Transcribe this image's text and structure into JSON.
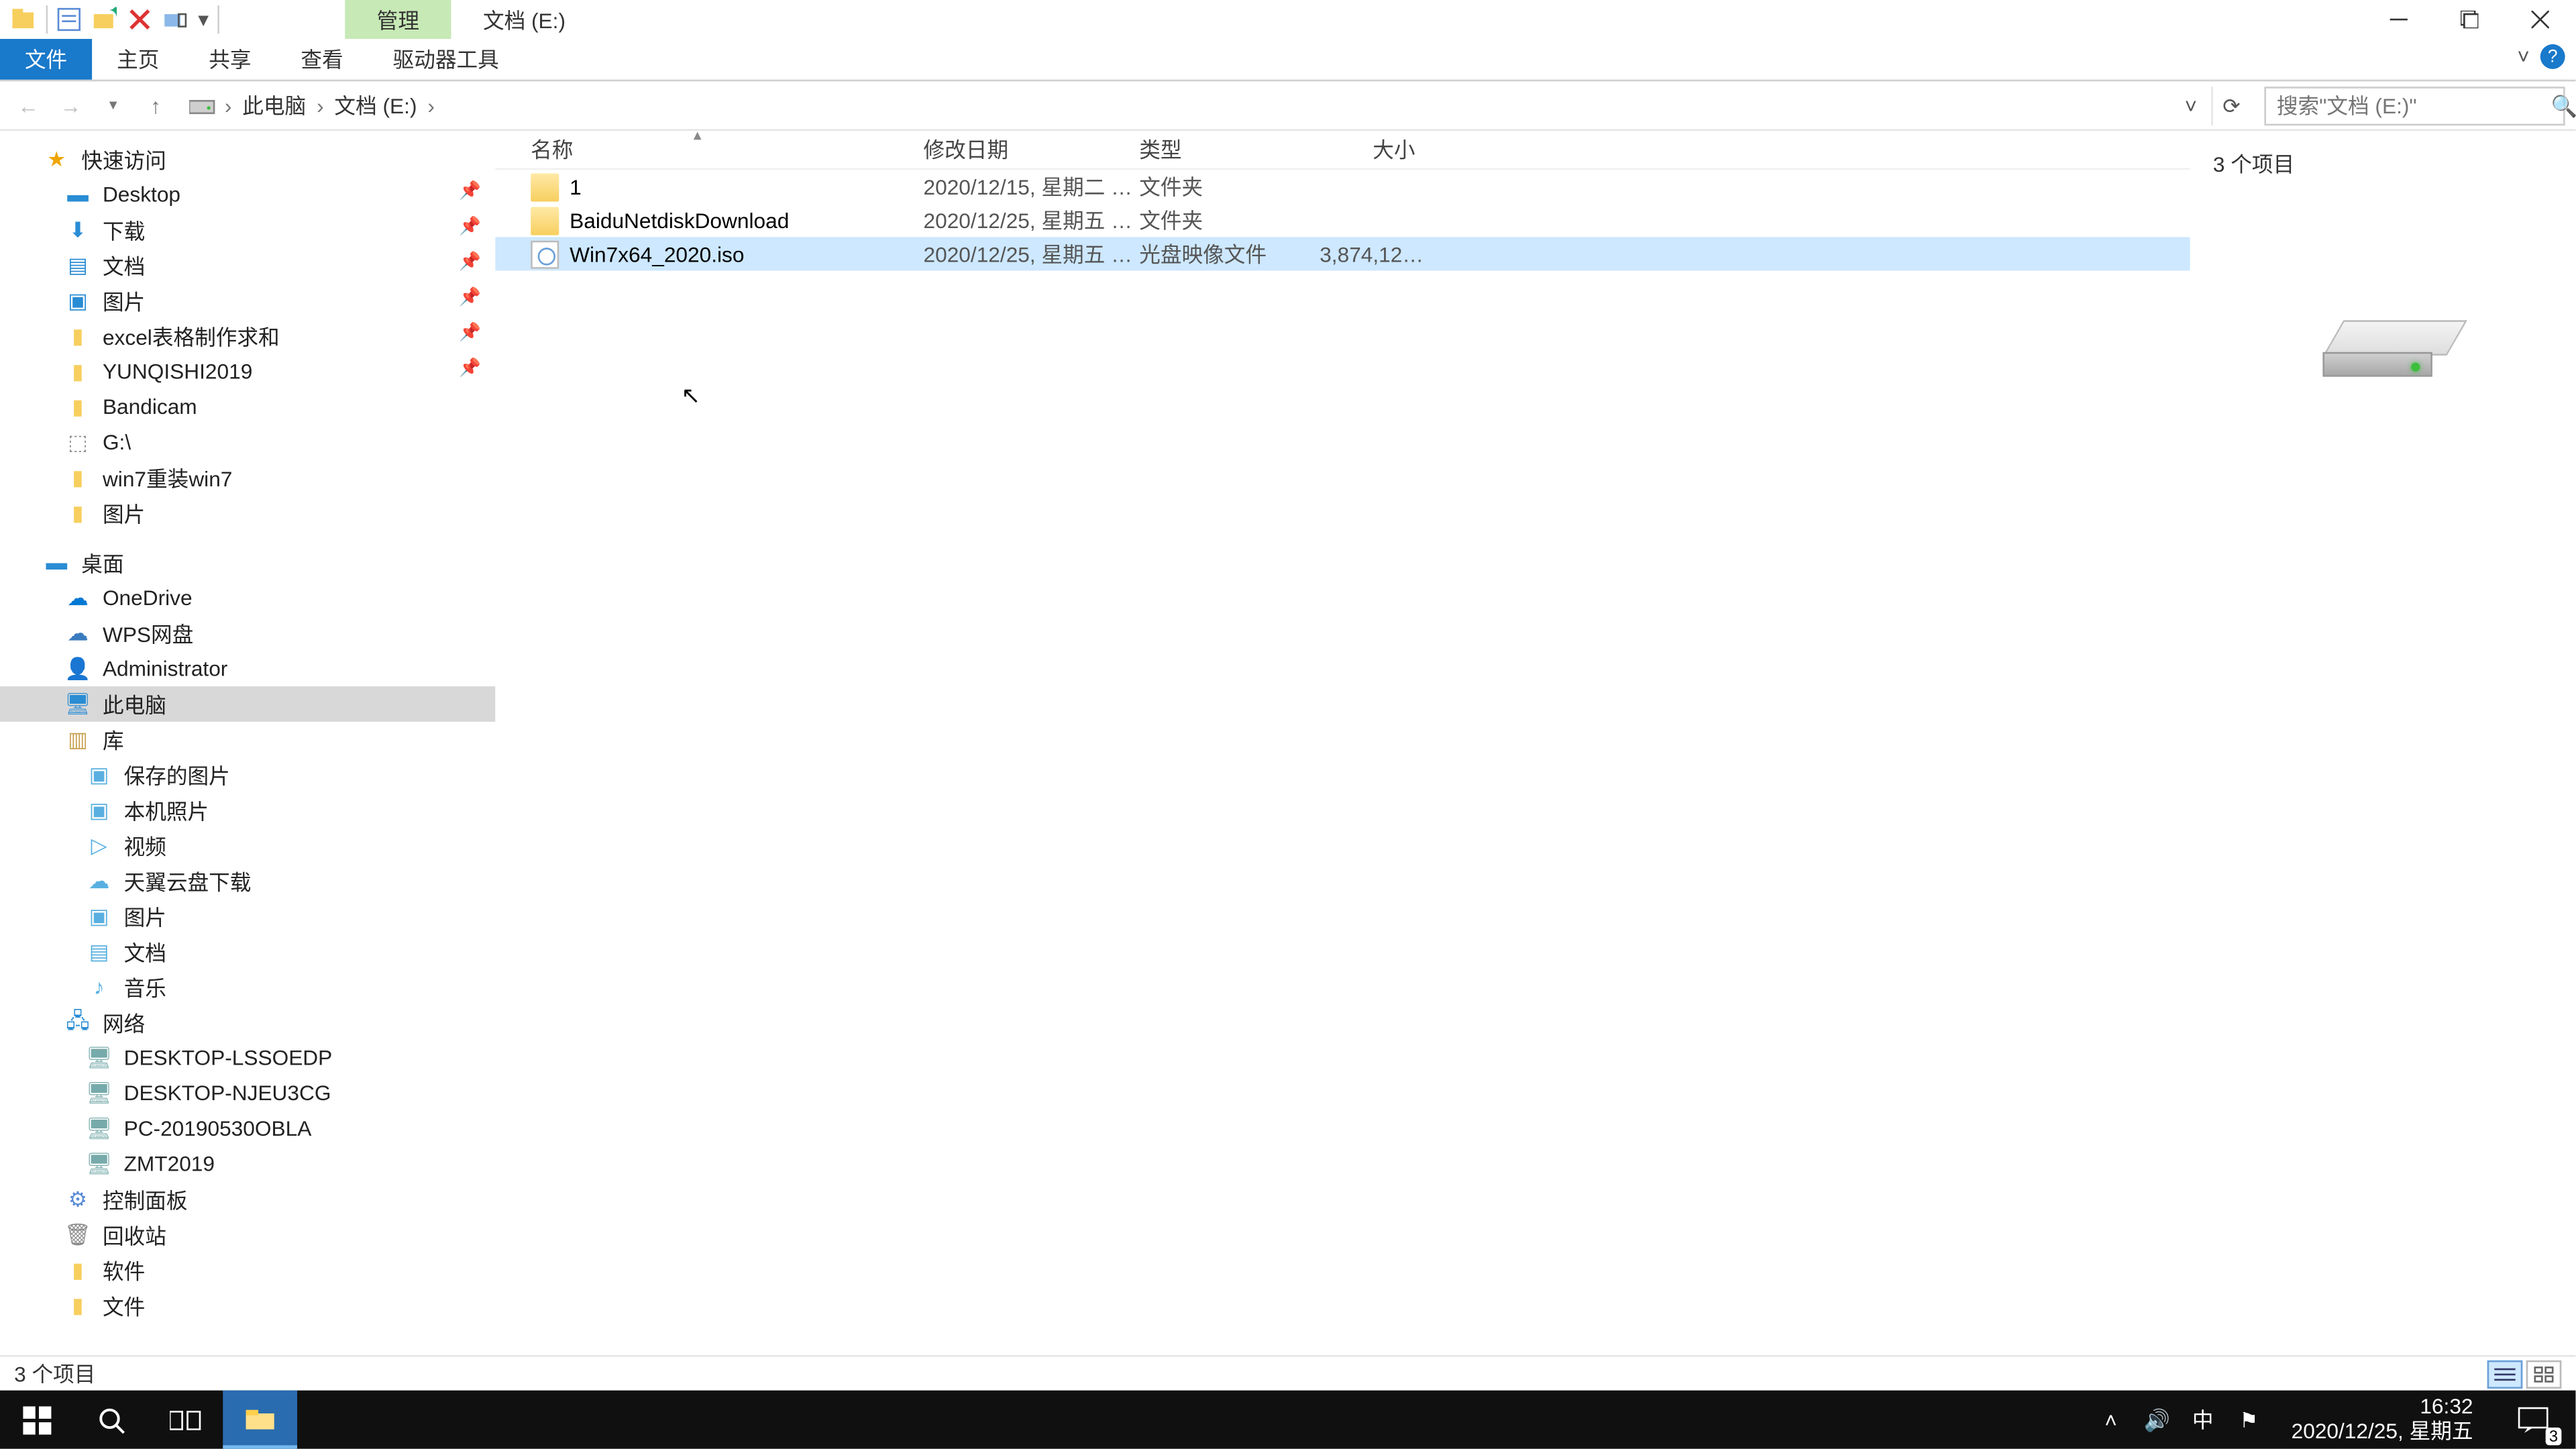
{
  "title_tab_context": "管理",
  "title_location": "文档 (E:)",
  "ribbon": {
    "file": "文件",
    "home": "主页",
    "share": "共享",
    "view": "查看",
    "drive_tools": "驱动器工具"
  },
  "breadcrumb": {
    "root": "此电脑",
    "current": "文档 (E:)"
  },
  "search": {
    "placeholder": "搜索\"文档 (E:)\""
  },
  "columns": {
    "name": "名称",
    "date": "修改日期",
    "type": "类型",
    "size": "大小"
  },
  "files": [
    {
      "name": "1",
      "date": "2020/12/15, 星期二 1...",
      "type": "文件夹",
      "size": "",
      "icon": "folder"
    },
    {
      "name": "BaiduNetdiskDownload",
      "date": "2020/12/25, 星期五 1...",
      "type": "文件夹",
      "size": "",
      "icon": "folder"
    },
    {
      "name": "Win7x64_2020.iso",
      "date": "2020/12/25, 星期五 1...",
      "type": "光盘映像文件",
      "size": "3,874,126...",
      "icon": "iso",
      "selected": true
    }
  ],
  "preview": {
    "count_label": "3 个项目"
  },
  "status": {
    "text": "3 个项目"
  },
  "sidebar": {
    "quick": "快速访问",
    "quick_items": [
      "Desktop",
      "下载",
      "文档",
      "图片",
      "excel表格制作求和",
      "YUNQISHI2019",
      "Bandicam",
      "G:\\",
      "win7重装win7",
      "图片"
    ],
    "desktop": "桌面",
    "desktop_items": [
      "OneDrive",
      "WPS网盘",
      "Administrator",
      "此电脑",
      "库"
    ],
    "lib_items": [
      "保存的图片",
      "本机照片",
      "视频",
      "天翼云盘下载",
      "图片",
      "文档",
      "音乐"
    ],
    "network": "网络",
    "net_items": [
      "DESKTOP-LSSOEDP",
      "DESKTOP-NJEU3CG",
      "PC-20190530OBLA",
      "ZMT2019"
    ],
    "others": [
      "控制面板",
      "回收站",
      "软件",
      "文件"
    ]
  },
  "tray": {
    "ime": "中",
    "time": "16:32",
    "date": "2020/12/25, 星期五",
    "notif_count": "3"
  }
}
